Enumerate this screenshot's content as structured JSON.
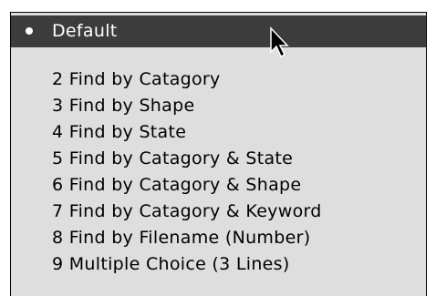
{
  "popup_menu": {
    "selected_item": {
      "label": "Default",
      "icon": "bullet-icon"
    },
    "items": [
      {
        "label": "2 Find by Catagory"
      },
      {
        "label": "3 Find by Shape"
      },
      {
        "label": "4 Find by State"
      },
      {
        "label": "5 Find by Catagory & State"
      },
      {
        "label": "6 Find by Catagory & Shape"
      },
      {
        "label": "7 Find by Catagory & Keyword"
      },
      {
        "label": "8 Find by Filename (Number)"
      },
      {
        "label": "9 Multiple Choice (3 Lines)"
      }
    ]
  },
  "colors": {
    "menu_background": "#dedede",
    "highlight_background": "#3c3c3c",
    "highlight_text": "#ffffff",
    "text": "#000000"
  },
  "cursor": {
    "icon": "arrow-cursor-icon"
  }
}
